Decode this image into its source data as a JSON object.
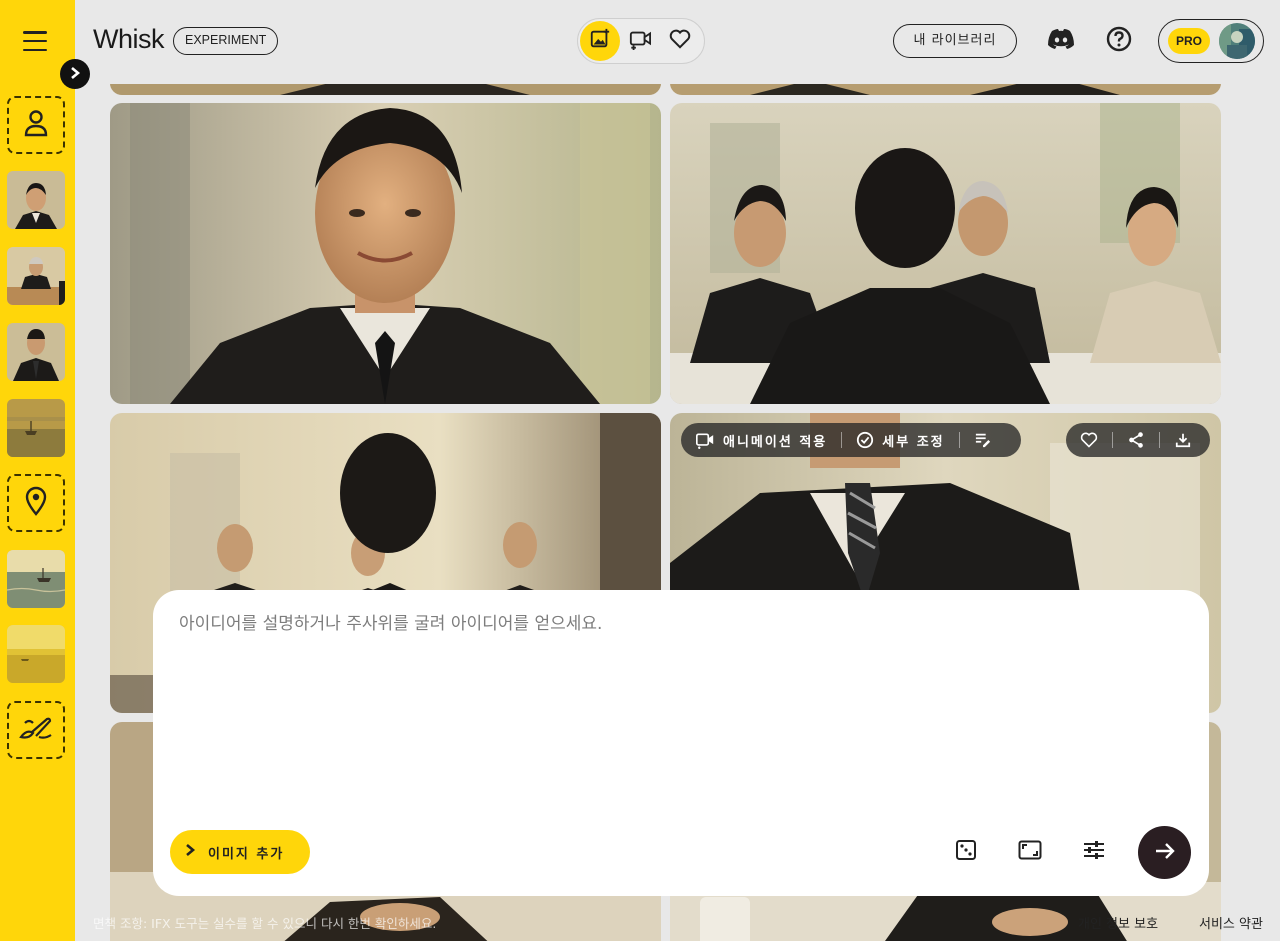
{
  "app": {
    "title": "Whisk",
    "badge": "EXPERIMENT"
  },
  "header": {
    "modes": [
      {
        "name": "image-mode",
        "icon": "image-add-icon",
        "active": true
      },
      {
        "name": "video-mode",
        "icon": "video-add-icon",
        "active": false
      },
      {
        "name": "favorites-mode",
        "icon": "heart-icon",
        "active": false
      }
    ],
    "library_label": "내 라이브러리",
    "pro_label": "PRO",
    "discord_icon": "discord-icon",
    "help_icon": "help-icon"
  },
  "sidebar": {
    "menu_icon": "menu-icon",
    "expand_icon": "chevron-right-icon",
    "slots": [
      {
        "type": "subject-placeholder",
        "icon": "person-icon"
      },
      {
        "type": "thumbnail",
        "content": "smiling man in suit"
      },
      {
        "type": "thumbnail",
        "content": "interview panel"
      },
      {
        "type": "thumbnail",
        "content": "man in suit"
      },
      {
        "type": "thumbnail",
        "content": "harbor boats"
      },
      {
        "type": "scene-placeholder",
        "icon": "location-pin-icon"
      },
      {
        "type": "thumbnail",
        "content": "sea with boats"
      },
      {
        "type": "thumbnail",
        "content": "golden sea"
      },
      {
        "type": "style-placeholder",
        "icon": "brush-icon"
      }
    ]
  },
  "card_toolbar": {
    "animate_label": "애니메이션 적용",
    "refine_label": "세부 조정",
    "edit_prompt_icon": "edit-prompt-icon",
    "favorite_icon": "heart-icon",
    "share_icon": "share-icon",
    "download_icon": "download-icon"
  },
  "prompt": {
    "placeholder": "아이디어를 설명하거나 주사위를 굴려 아이디어를 얻으세요.",
    "value": "",
    "add_image_label": "이미지 추가",
    "tools": [
      "dice-icon",
      "aspect-ratio-icon",
      "settings-sliders-icon"
    ],
    "submit_icon": "arrow-right-icon"
  },
  "footer": {
    "disclaimer": "면책 조항: IFX 도구는 실수를 할 수 있으니 다시 한번 확인하세요.",
    "privacy_label": "개인 정보 보호",
    "terms_label": "서비스 약관"
  },
  "colors": {
    "accent": "#ffd60a",
    "dark": "#1f1f1f",
    "background": "#e8e8e8",
    "send_button": "#2a1e22"
  }
}
